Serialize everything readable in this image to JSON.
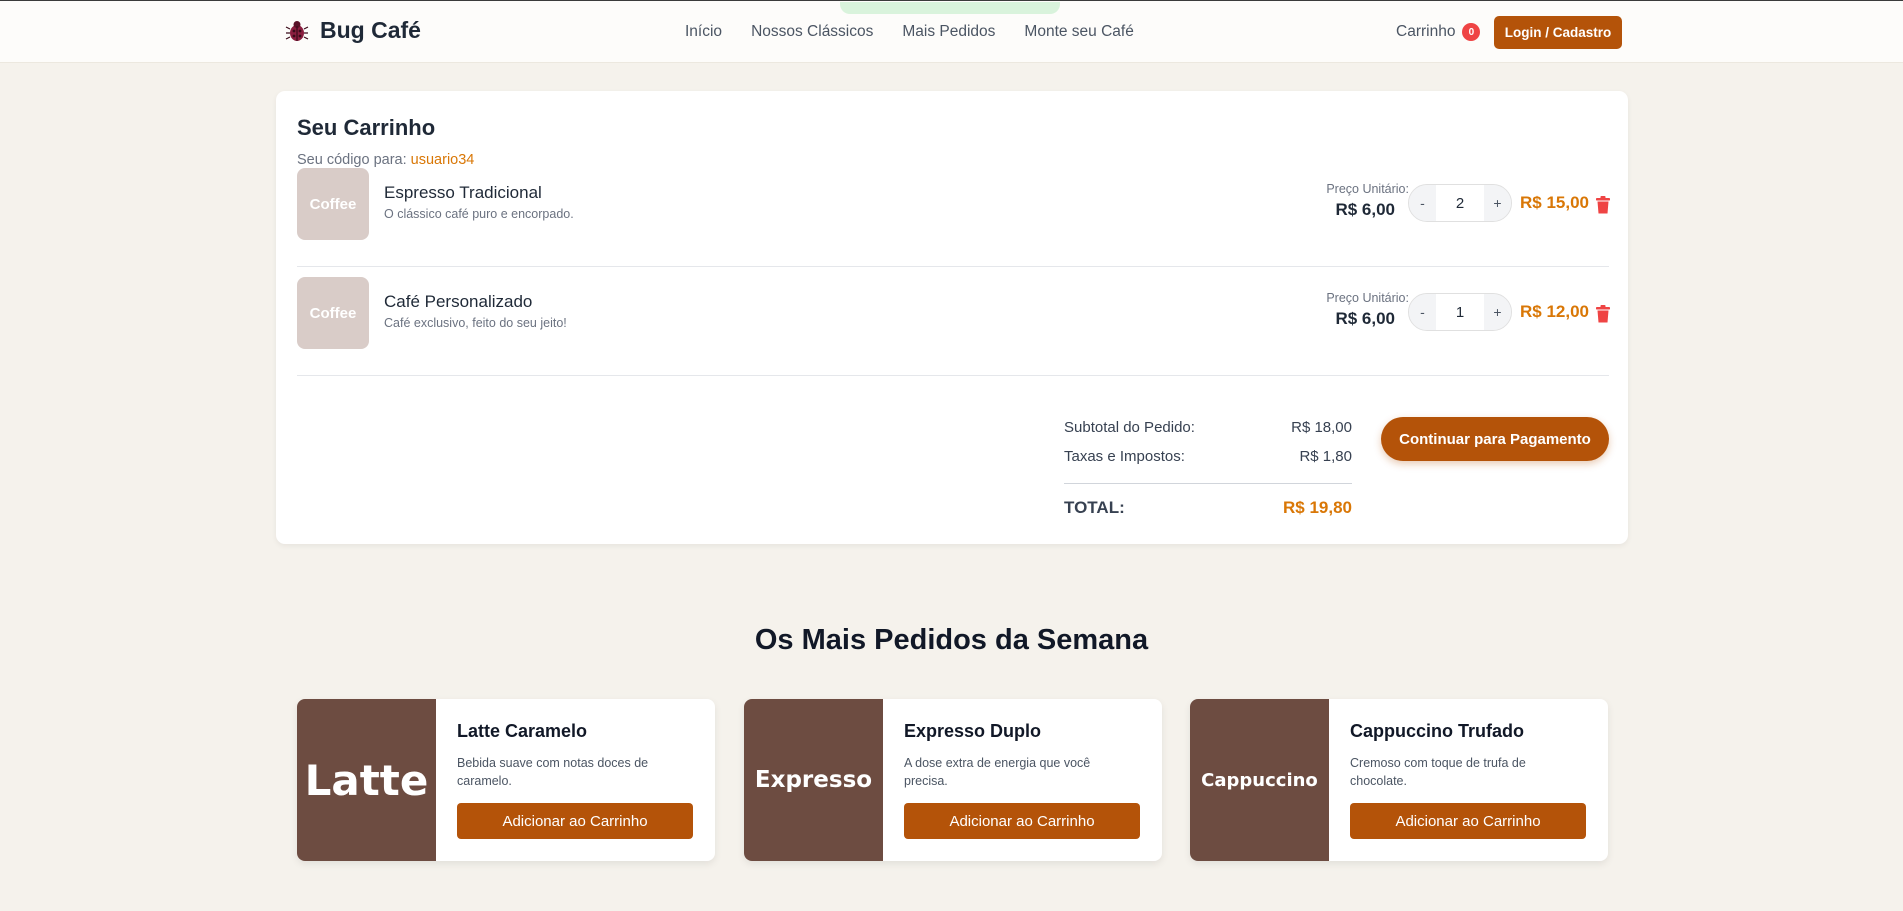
{
  "header": {
    "brand": "Bug Café",
    "nav": [
      "Início",
      "Nossos Clássicos",
      "Mais Pedidos",
      "Monte seu Café"
    ],
    "cart_label": "Carrinho",
    "cart_count": "0",
    "login_label": "Login / Cadastro"
  },
  "cart": {
    "title": "Seu Carrinho",
    "code_prefix": "Seu código para: ",
    "code_user": "usuario34",
    "unit_label": "Preço Unitário:",
    "items": [
      {
        "thumb": "Coffee",
        "name": "Espresso Tradicional",
        "desc": "O clássico café puro e encorpado.",
        "unit_price": "R$ 6,00",
        "qty": "2",
        "total": "R$ 15,00"
      },
      {
        "thumb": "Coffee",
        "name": "Café Personalizado",
        "desc": "Café exclusivo, feito do seu jeito!",
        "unit_price": "R$ 6,00",
        "qty": "1",
        "total": "R$ 12,00"
      }
    ],
    "qty_minus": "-",
    "qty_plus": "+",
    "summary": {
      "subtotal_label": "Subtotal do Pedido:",
      "subtotal_value": "R$ 18,00",
      "tax_label": "Taxas e Impostos:",
      "tax_value": "R$ 1,80",
      "total_label": "TOTAL:",
      "total_value": "R$ 19,80"
    },
    "pay_label": "Continuar para Pagamento"
  },
  "popular": {
    "title": "Os Mais Pedidos da Semana",
    "products": [
      {
        "image_text": "Latte",
        "name": "Latte Caramelo",
        "desc": "Bebida suave com notas doces de caramelo.",
        "button": "Adicionar ao Carrinho"
      },
      {
        "image_text": "Expresso",
        "name": "Expresso Duplo",
        "desc": "A dose extra de energia que você precisa.",
        "button": "Adicionar ao Carrinho"
      },
      {
        "image_text": "Cappuccino",
        "name": "Cappuccino Trufado",
        "desc": "Cremoso com toque de trufa de chocolate.",
        "button": "Adicionar ao Carrinho"
      }
    ]
  },
  "colors": {
    "accent": "#b45309",
    "price": "#d97706",
    "badge": "#ef4444",
    "product_image": "#6d4c41"
  }
}
